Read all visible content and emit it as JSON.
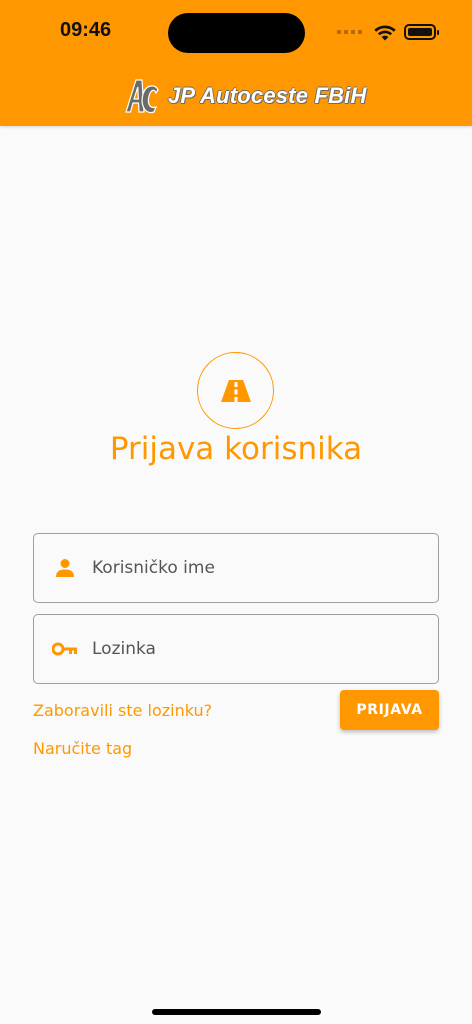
{
  "status_bar": {
    "time": "09:46"
  },
  "header": {
    "logo_text": "JP Autoceste FBiH"
  },
  "login": {
    "title": "Prijava korisnika",
    "username_placeholder": "Korisničko ime",
    "password_placeholder": "Lozinka",
    "forgot_password": "Zaboravili ste lozinku?",
    "login_button": "PRIJAVA",
    "order_tag": "Naručite tag"
  },
  "colors": {
    "accent": "#ff9800",
    "background": "#fafafa",
    "field_border": "#9e9e9e"
  },
  "icons": {
    "road": "road-icon",
    "user": "user-icon",
    "key": "key-icon",
    "wifi": "wifi-icon",
    "battery": "battery-icon"
  }
}
